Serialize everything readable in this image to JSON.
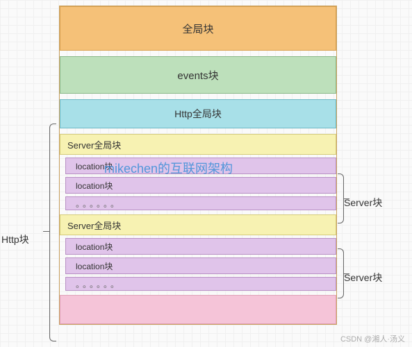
{
  "blocks": {
    "global": "全局块",
    "events": "events块",
    "httpGlobal": "Http全局块",
    "serverGlobal1": "Server全局块",
    "location1a": "location块",
    "location1b": "location块",
    "dots1": "。。。。。。",
    "serverGlobal2": "Server全局块",
    "location2a": "location块",
    "location2b": "location块",
    "dots2": "。。。。。。"
  },
  "labels": {
    "httpBracket": "Http块",
    "serverBracket1": "Server块",
    "serverBracket2": "Server块"
  },
  "watermark": "mikechen的互联网架构",
  "footer": "CSDN @湘人·汤义"
}
